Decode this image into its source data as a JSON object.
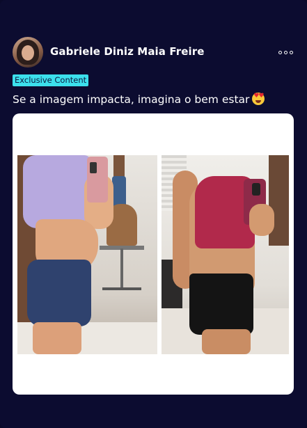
{
  "post": {
    "author_name": "Gabriele Diniz Maia Freire",
    "badge": "Exclusive Content",
    "caption": "Se a imagem impacta, imagina o bem estar",
    "caption_emoji": "heart-eyes-emoji"
  },
  "icons": {
    "more": "more-options-icon",
    "avatar": "author-avatar"
  },
  "colors": {
    "background": "#0c0c30",
    "badge_bg": "#3ce0ec",
    "badge_text": "#0b1a40",
    "text": "#ffffff",
    "media_bg": "#ffffff"
  }
}
